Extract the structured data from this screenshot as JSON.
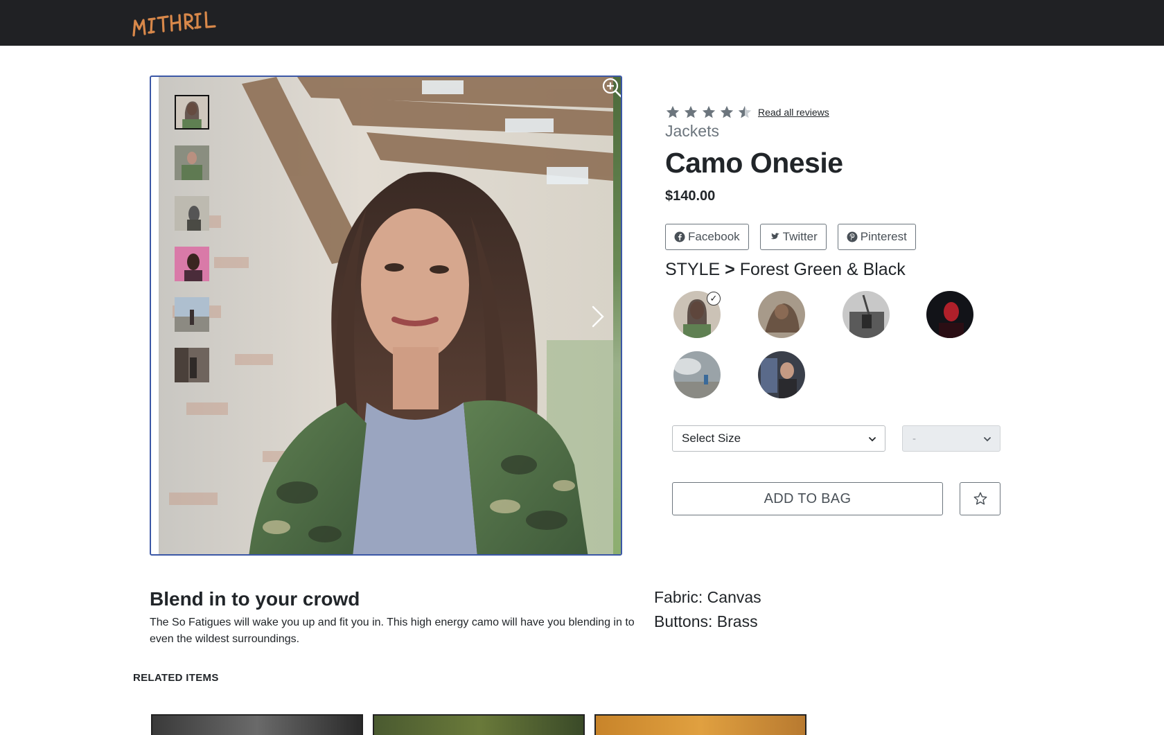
{
  "brand": {
    "logo_text": "MITHRIL",
    "accent": "#d8884a"
  },
  "gallery": {
    "thumbnail_count": 6,
    "active_thumbnail": 1,
    "thumbnail_names": [
      "thumb-1",
      "thumb-2",
      "thumb-3",
      "thumb-4",
      "thumb-5",
      "thumb-6"
    ],
    "zoom_icon": "zoom-in-icon",
    "next_icon": "chevron-right-icon"
  },
  "product": {
    "rating": 4.5,
    "rating_max": 5,
    "reviews_link": "Read all reviews",
    "category": "Jackets",
    "name": "Camo Onesie",
    "price": "$140.00"
  },
  "share": [
    {
      "label": "Facebook",
      "icon": "facebook-icon"
    },
    {
      "label": "Twitter",
      "icon": "twitter-icon"
    },
    {
      "label": "Pinterest",
      "icon": "pinterest-icon"
    }
  ],
  "style": {
    "prefix": "STYLE",
    "separator": ">",
    "selected": "Forest Green & Black",
    "swatch_count": 6,
    "selected_index": 0
  },
  "selectors": {
    "size_label": "Select Size",
    "quantity_label": "-"
  },
  "actions": {
    "add_to_bag": "ADD TO BAG",
    "favorite_icon": "star-outline-icon"
  },
  "description": {
    "heading": "Blend in to your crowd",
    "body": "The So Fatigues will wake you up and fit you in. This high energy camo will have you blending in to even the wildest surroundings."
  },
  "specs": [
    "Fabric: Canvas",
    "Buttons: Brass"
  ],
  "related": {
    "heading": "RELATED ITEMS"
  },
  "colors": {
    "header_bg": "#202124",
    "gallery_border": "#3b57a6",
    "star": "#6c757d"
  }
}
